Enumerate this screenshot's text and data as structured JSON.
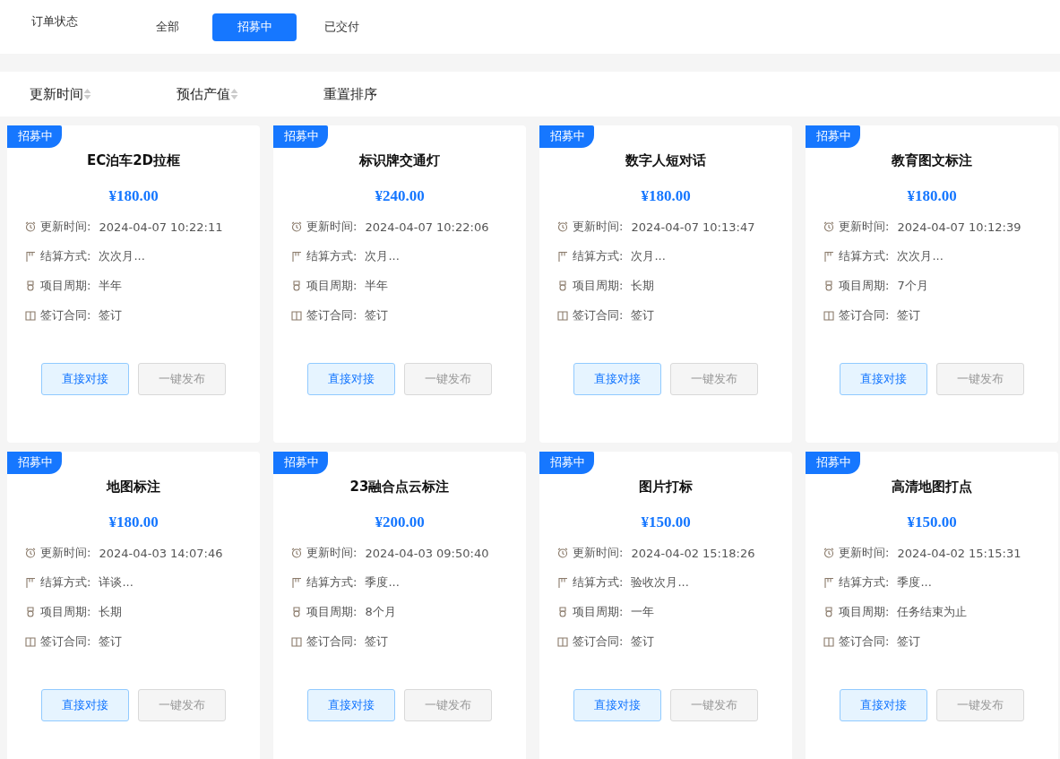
{
  "status_filter": {
    "label": "订单状态",
    "tabs": [
      {
        "label": "全部",
        "selected": false
      },
      {
        "label": "招募中",
        "selected": true
      },
      {
        "label": "已交付",
        "selected": false
      }
    ]
  },
  "sort_bar": [
    {
      "label": "更新时间",
      "sortable": true
    },
    {
      "label": "预估产值",
      "sortable": true
    },
    {
      "label": "重置排序",
      "sortable": false
    }
  ],
  "cards": [
    {
      "badge": "招募中",
      "title": "EC泊车2D拉框",
      "price": "¥180.00",
      "fields": [
        {
          "kind": "time",
          "label": "更新时间:",
          "value": "2024-04-07 10:22:11"
        },
        {
          "kind": "settle",
          "label": "结算方式:",
          "value": "次次月..."
        },
        {
          "kind": "period",
          "label": "项目周期:",
          "value": "半年"
        },
        {
          "kind": "contract",
          "label": "签订合同:",
          "value": "签订"
        }
      ],
      "buttons": [
        {
          "label": "直接对接",
          "disabled": false
        },
        {
          "label": "一键发布",
          "disabled": true
        }
      ]
    },
    {
      "badge": "招募中",
      "title": "标识牌交通灯",
      "price": "¥240.00",
      "fields": [
        {
          "kind": "time",
          "label": "更新时间:",
          "value": "2024-04-07 10:22:06"
        },
        {
          "kind": "settle",
          "label": "结算方式:",
          "value": "次月..."
        },
        {
          "kind": "period",
          "label": "项目周期:",
          "value": "半年"
        },
        {
          "kind": "contract",
          "label": "签订合同:",
          "value": "签订"
        }
      ],
      "buttons": [
        {
          "label": "直接对接",
          "disabled": false
        },
        {
          "label": "一键发布",
          "disabled": true
        }
      ]
    },
    {
      "badge": "招募中",
      "title": "数字人短对话",
      "price": "¥180.00",
      "fields": [
        {
          "kind": "time",
          "label": "更新时间:",
          "value": "2024-04-07 10:13:47"
        },
        {
          "kind": "settle",
          "label": "结算方式:",
          "value": "次月..."
        },
        {
          "kind": "period",
          "label": "项目周期:",
          "value": "长期"
        },
        {
          "kind": "contract",
          "label": "签订合同:",
          "value": "签订"
        }
      ],
      "buttons": [
        {
          "label": "直接对接",
          "disabled": false
        },
        {
          "label": "一键发布",
          "disabled": true
        }
      ]
    },
    {
      "badge": "招募中",
      "title": "教育图文标注",
      "price": "¥180.00",
      "fields": [
        {
          "kind": "time",
          "label": "更新时间:",
          "value": "2024-04-07 10:12:39"
        },
        {
          "kind": "settle",
          "label": "结算方式:",
          "value": "次次月..."
        },
        {
          "kind": "period",
          "label": "项目周期:",
          "value": "7个月"
        },
        {
          "kind": "contract",
          "label": "签订合同:",
          "value": "签订"
        }
      ],
      "buttons": [
        {
          "label": "直接对接",
          "disabled": false
        },
        {
          "label": "一键发布",
          "disabled": true
        }
      ]
    },
    {
      "badge": "招募中",
      "title": "地图标注",
      "price": "¥180.00",
      "fields": [
        {
          "kind": "time",
          "label": "更新时间:",
          "value": "2024-04-03 14:07:46"
        },
        {
          "kind": "settle",
          "label": "结算方式:",
          "value": "详谈..."
        },
        {
          "kind": "period",
          "label": "项目周期:",
          "value": "长期"
        },
        {
          "kind": "contract",
          "label": "签订合同:",
          "value": "签订"
        }
      ],
      "buttons": [
        {
          "label": "直接对接",
          "disabled": false
        },
        {
          "label": "一键发布",
          "disabled": true
        }
      ]
    },
    {
      "badge": "招募中",
      "title": "23融合点云标注",
      "price": "¥200.00",
      "fields": [
        {
          "kind": "time",
          "label": "更新时间:",
          "value": "2024-04-03 09:50:40"
        },
        {
          "kind": "settle",
          "label": "结算方式:",
          "value": "季度..."
        },
        {
          "kind": "period",
          "label": "项目周期:",
          "value": "8个月"
        },
        {
          "kind": "contract",
          "label": "签订合同:",
          "value": "签订"
        }
      ],
      "buttons": [
        {
          "label": "直接对接",
          "disabled": false
        },
        {
          "label": "一键发布",
          "disabled": true
        }
      ]
    },
    {
      "badge": "招募中",
      "title": "图片打标",
      "price": "¥150.00",
      "fields": [
        {
          "kind": "time",
          "label": "更新时间:",
          "value": "2024-04-02 15:18:26"
        },
        {
          "kind": "settle",
          "label": "结算方式:",
          "value": "验收次月..."
        },
        {
          "kind": "period",
          "label": "项目周期:",
          "value": "一年"
        },
        {
          "kind": "contract",
          "label": "签订合同:",
          "value": "签订"
        }
      ],
      "buttons": [
        {
          "label": "直接对接",
          "disabled": false
        },
        {
          "label": "一键发布",
          "disabled": true
        }
      ]
    },
    {
      "badge": "招募中",
      "title": "高清地图打点",
      "price": "¥150.00",
      "fields": [
        {
          "kind": "time",
          "label": "更新时间:",
          "value": "2024-04-02 15:15:31"
        },
        {
          "kind": "settle",
          "label": "结算方式:",
          "value": "季度..."
        },
        {
          "kind": "period",
          "label": "项目周期:",
          "value": "任务结束为止"
        },
        {
          "kind": "contract",
          "label": "签订合同:",
          "value": "签订"
        }
      ],
      "buttons": [
        {
          "label": "直接对接",
          "disabled": false
        },
        {
          "label": "一键发布",
          "disabled": true
        }
      ]
    }
  ]
}
